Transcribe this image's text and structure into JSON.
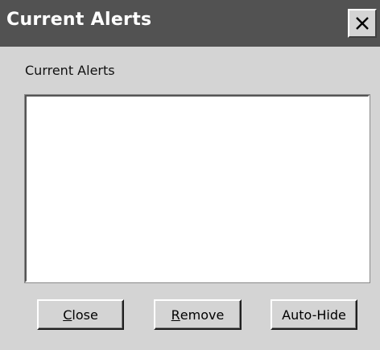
{
  "window": {
    "title": "Current Alerts",
    "close_icon": "close-icon"
  },
  "main": {
    "group_label": "Current Alerts",
    "alerts": []
  },
  "buttons": {
    "close": {
      "mnemonic": "C",
      "rest": "lose"
    },
    "remove": {
      "mnemonic": "R",
      "rest": "emove"
    },
    "autohide": {
      "label": "Auto-Hide"
    }
  },
  "colors": {
    "titlebar": "#525252",
    "title_text": "#ffffff",
    "dialog_face": "#d4d4d4",
    "list_background": "#ffffff"
  }
}
